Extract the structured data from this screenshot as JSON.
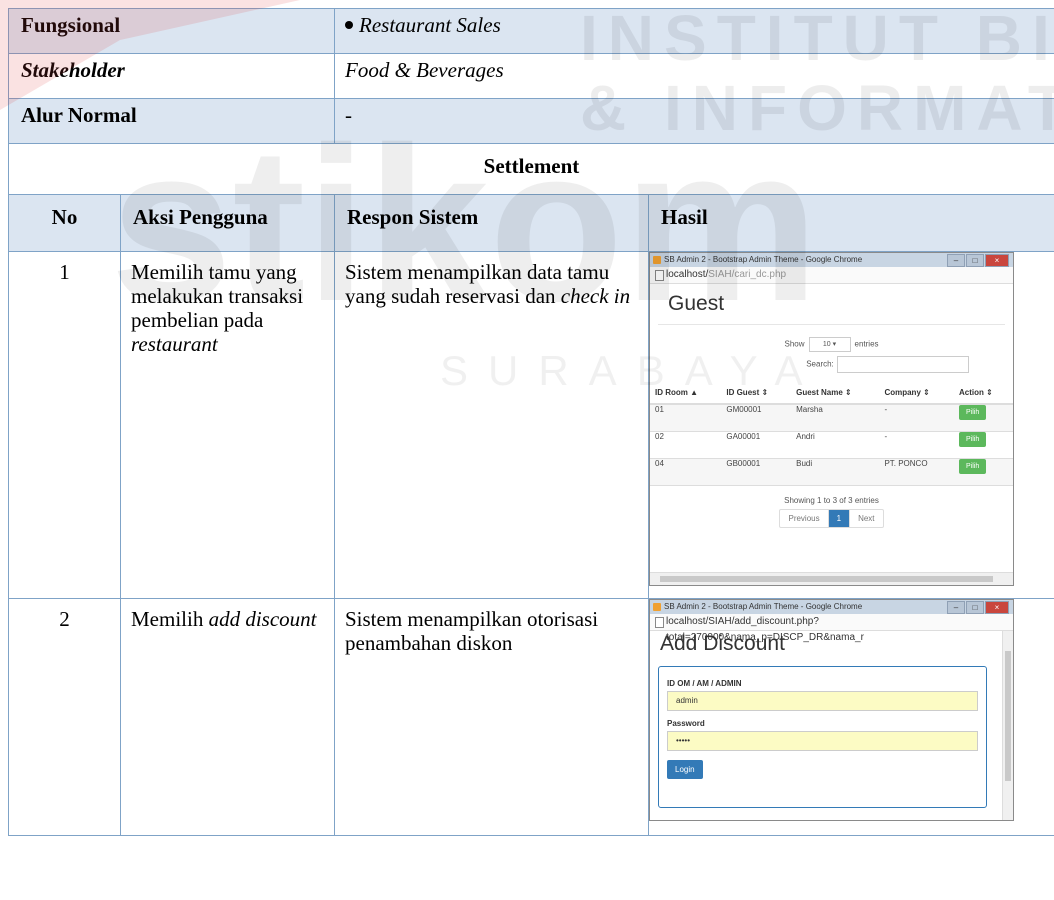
{
  "rows": {
    "fungsional": {
      "label": "Fungsional",
      "value": "Restaurant Sales"
    },
    "stakeholder": {
      "label": "Stakeholder",
      "value": "Food & Beverages"
    },
    "alur": {
      "label": "Alur Normal",
      "value": "-"
    },
    "section": "Settlement"
  },
  "columns": {
    "no": "No",
    "aksi": "Aksi Pengguna",
    "respon": "Respon Sistem",
    "hasil": "Hasil"
  },
  "steps": [
    {
      "no": "1",
      "aksi_plain": "Memilih tamu yang melakukan transaksi pembelian pada",
      "aksi_italic": "restaurant",
      "respon_plain": "Sistem menampilkan data tamu yang sudah reservasi dan",
      "respon_italic": "check in"
    },
    {
      "no": "2",
      "aksi_plain": "Memilih",
      "aksi_italic": "add discount",
      "respon_plain": "Sistem menampilkan otorisasi penambahan diskon",
      "respon_italic": ""
    }
  ],
  "shot1": {
    "window_title": "SB Admin 2 - Bootstrap Admin Theme - Google Chrome",
    "url_host": "localhost/",
    "url_path": "SIAH/cari_dc.php",
    "page_title": "Guest",
    "show_label": "Show",
    "show_value": "10",
    "entries_label": "entries",
    "search_label": "Search:",
    "headers": [
      "ID Room",
      "ID Guest",
      "Guest Name",
      "Company",
      "Action"
    ],
    "rows": [
      {
        "room": "01",
        "guest": "GM00001",
        "name": "Marsha",
        "company": "-",
        "action": "Pilih"
      },
      {
        "room": "02",
        "guest": "GA00001",
        "name": "Andri",
        "company": "-",
        "action": "Pilih"
      },
      {
        "room": "04",
        "guest": "GB00001",
        "name": "Budi",
        "company": "PT. PONCO",
        "action": "Pilih"
      }
    ],
    "info": "Showing 1 to 3 of 3 entries",
    "prev": "Previous",
    "page": "1",
    "next": "Next"
  },
  "shot2": {
    "window_title": "SB Admin 2 - Bootstrap Admin Theme - Google Chrome",
    "url": "localhost/SIAH/add_discount.php?total=270000&nama_p=DISCP_DR&nama_r",
    "page_title": "Add Discount",
    "id_label": "ID OM / AM / ADMIN",
    "id_value": "admin",
    "password_label": "Password",
    "password_value": "•••••",
    "login": "Login"
  },
  "watermark": {
    "line1": "INSTITUT BISNIS",
    "line2": "& INFORMATIKA",
    "logo": "stikom",
    "city": "SURABAYA",
    "accent": "#e03a3e"
  }
}
